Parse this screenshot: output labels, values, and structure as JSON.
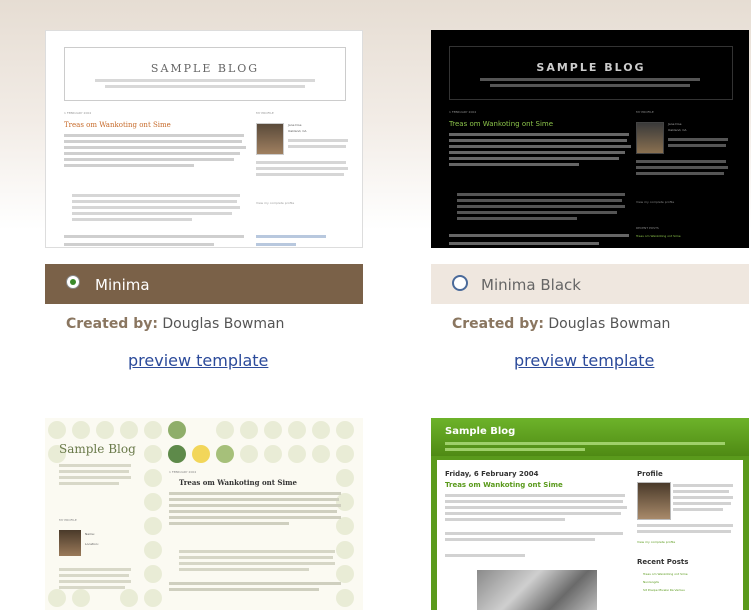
{
  "templates": [
    {
      "name": "Minima",
      "selected": true,
      "created_by_label": "Created by:",
      "author": "Douglas Bowman",
      "preview_label": "preview template",
      "thumb": {
        "blog_title": "SAMPLE BLOG",
        "date": "1 FEBRUARY 2004",
        "post_title": "Treas om Wankoting ont Sime",
        "sidebar_head": "MY PROFILE",
        "name": "Jane Doe",
        "location": "Oakland, CA",
        "link": "View my complete profile"
      }
    },
    {
      "name": "Minima Black",
      "selected": false,
      "created_by_label": "Created by:",
      "author": "Douglas Bowman",
      "preview_label": "preview template",
      "thumb": {
        "blog_title": "SAMPLE BLOG",
        "date": "1 FEBRUARY 2004",
        "post_title": "Treas om Wankoting ont Sime",
        "sidebar_head": "MY PROFILE",
        "name": "Jane Doe",
        "location": "Oakland, CA",
        "link": "View my complete profile",
        "recent_head": "RECENT POSTS",
        "recent_item": "Treas om Wankoting ont Sime"
      }
    },
    {
      "thumb": {
        "blog_title": "Sample Blog",
        "date": "1 FEBRUARY 2004",
        "post_title": "Treas om Wankoting ont Sime",
        "sidebar_head": "MY PROFILE",
        "name": "Name:",
        "location": "Location:"
      }
    },
    {
      "thumb": {
        "blog_title": "Sample Blog",
        "date": "Friday, 6 February 2004",
        "post_title": "Treas om Wankoting ont Sime",
        "profile_head": "Profile",
        "recent_head": "Recent Posts",
        "recent_items": [
          "Treas om Wankoting ont Sime",
          "Nunlangds",
          "Sit Posipe Mivelsi Ra Verlieu"
        ],
        "link": "View my complete profile"
      }
    }
  ],
  "colors": {
    "selected_bar": "#7a6148",
    "unselected_bar": "#efe7df",
    "radio_accent": "#3a8a2a",
    "link": "#2b4a9a",
    "stretch_green": "#5a9a1c"
  }
}
